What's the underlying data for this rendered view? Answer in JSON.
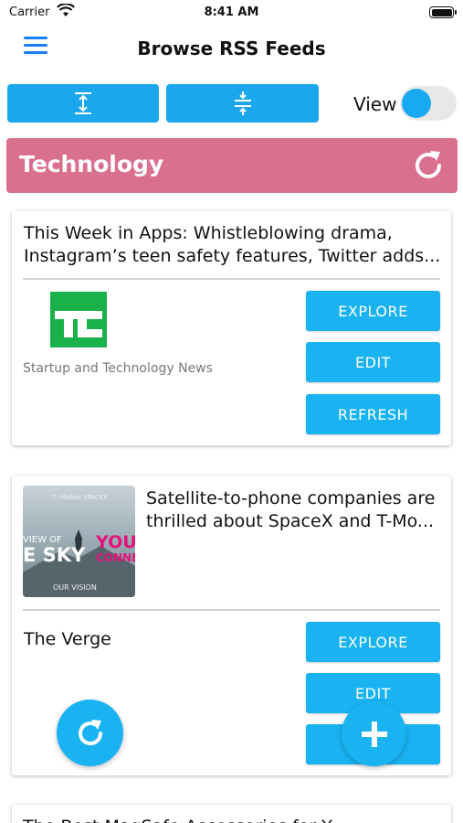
{
  "status_bar": {
    "carrier": "Carrier",
    "time": "8:41 AM"
  },
  "nav": {
    "title": "Browse RSS Feeds",
    "menu_icon": "hamburger-menu-icon"
  },
  "toolbar": {
    "view_label": "View",
    "expand_icon": "expand-vertical-icon",
    "collapse_icon": "collapse-vertical-icon",
    "toggle_on": true
  },
  "category": {
    "title": "Technology",
    "color": "#d9708f",
    "refresh_icon": "refresh-icon"
  },
  "feeds": [
    {
      "headline": "This Week in Apps: Whistleblowing drama, Instagram’s teen safety features, Twitter adds...",
      "logo_text": "TC",
      "source_desc": "Startup and Technology News",
      "buttons": [
        "EXPLORE",
        "EDIT",
        "REFRESH"
      ]
    },
    {
      "headline": "Satellite-to-phone companies are thrilled about SpaceX and T-Mo...",
      "thumb_text": {
        "top": "T··Mobile  SPACEX",
        "left1": "VIEW OF",
        "left2": "E SKY",
        "right1": "YOU",
        "right2": "CONNE",
        "bottom": "OUR VISION"
      },
      "source_name": "The Verge",
      "buttons": [
        "EXPLORE",
        "EDIT"
      ]
    },
    {
      "headline": "The Best MagSafe Accessories for Y..."
    }
  ],
  "colors": {
    "accent": "#19b3f2",
    "menu": "#1a7df2"
  },
  "fabs": {
    "refresh_icon": "refresh-icon",
    "add_icon": "plus-icon"
  }
}
